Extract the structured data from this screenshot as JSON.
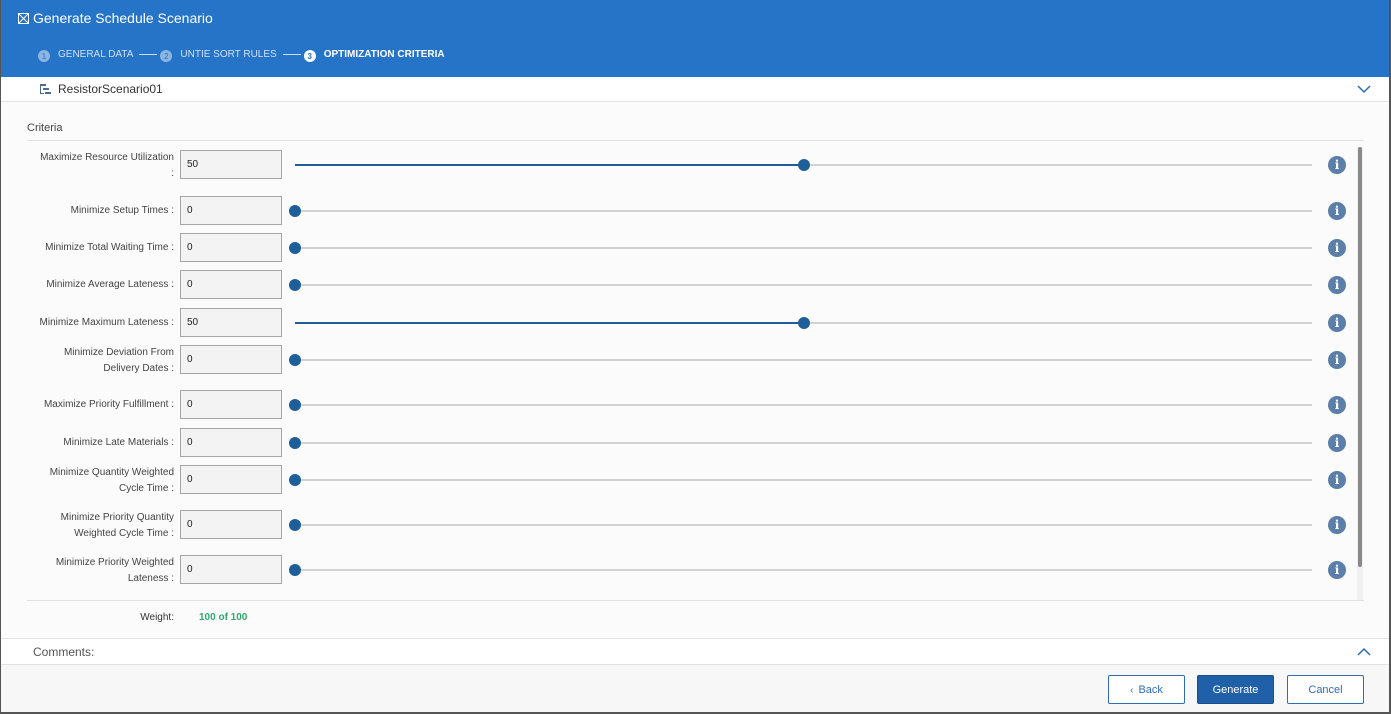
{
  "dialog": {
    "title": "Generate Schedule Scenario"
  },
  "steps": [
    {
      "num": "1",
      "label": "GENERAL DATA",
      "active": false
    },
    {
      "num": "2",
      "label": "UNTIE SORT RULES",
      "active": false
    },
    {
      "num": "3",
      "label": "OPTIMIZATION CRITERIA",
      "active": true
    }
  ],
  "scenario": {
    "name": "ResistorScenario01"
  },
  "criteria": {
    "title": "Criteria",
    "max": 100,
    "rows": [
      {
        "label_lines": [
          "Maximize Resource Utilization",
          ":"
        ],
        "value": "50"
      },
      {
        "label_lines": [
          "Minimize Setup Times :"
        ],
        "value": "0"
      },
      {
        "label_lines": [
          "Minimize Total Waiting Time :"
        ],
        "value": "0"
      },
      {
        "label_lines": [
          "Minimize Average Lateness :"
        ],
        "value": "0"
      },
      {
        "label_lines": [
          "Minimize Maximum Lateness :"
        ],
        "value": "50"
      },
      {
        "label_lines": [
          "Minimize Deviation From",
          "Delivery Dates :"
        ],
        "value": "0"
      },
      {
        "label_lines": [
          "Maximize Priority Fulfillment :"
        ],
        "value": "0"
      },
      {
        "label_lines": [
          "Minimize Late Materials :"
        ],
        "value": "0"
      },
      {
        "label_lines": [
          "Minimize Quantity Weighted",
          "Cycle Time :"
        ],
        "value": "0"
      },
      {
        "label_lines": [
          "Minimize Priority Quantity",
          "Weighted Cycle Time :"
        ],
        "value": "0"
      },
      {
        "label_lines": [
          "Minimize Priority Weighted",
          "Lateness :"
        ],
        "value": "0"
      }
    ]
  },
  "weight": {
    "label": "Weight:",
    "value": "100 of 100"
  },
  "comments": {
    "label": "Comments:"
  },
  "footer": {
    "back_label": "Back",
    "generate_label": "Generate",
    "cancel_label": "Cancel"
  },
  "icons": {
    "title": "grid-dialog-icon",
    "scenario": "hierarchy-tree-icon",
    "info": "info-icon",
    "collapse": "chevron-down-icon",
    "expand": "chevron-up-icon",
    "back": "chevron-left-icon"
  },
  "colors": {
    "header": "#2574c8",
    "slider": "#1f5f99",
    "weight_ok": "#2eaa6e",
    "primary_button": "#2060a8"
  }
}
